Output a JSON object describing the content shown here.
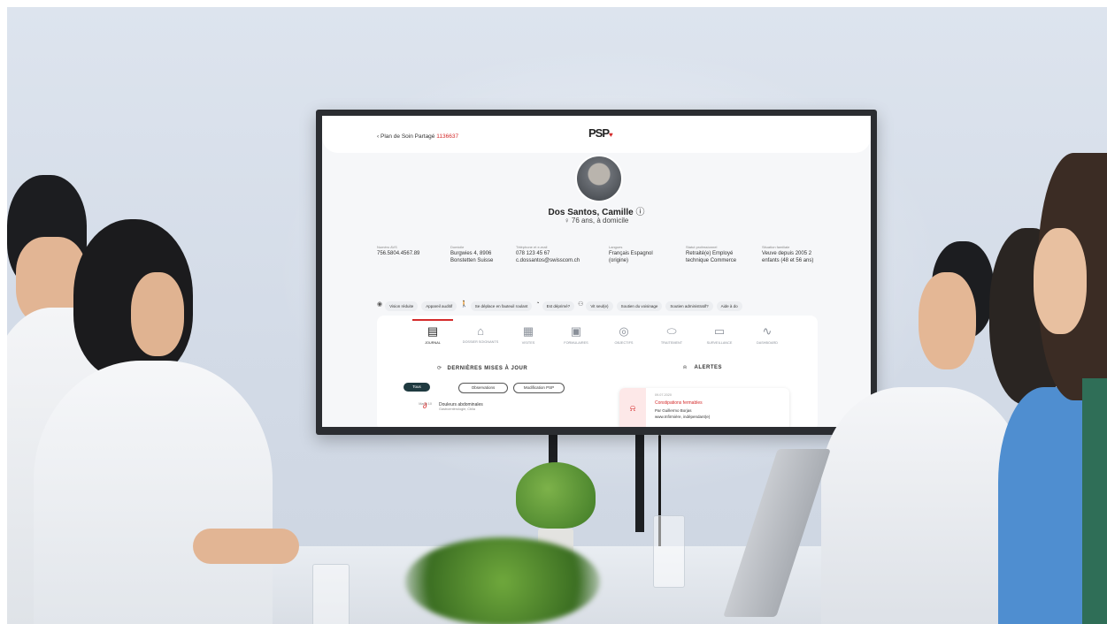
{
  "tv": {
    "back_label": "Plan de Soin Partagé",
    "back_id": "1136637",
    "logo": "PSP",
    "patient_name": "Dos Santos, Camille",
    "info_icon": "info-circle-icon",
    "patient_age": "♀ 76 ans, à domicile",
    "info_fields": [
      {
        "label": "Numéro AVS",
        "value": "756.5804.4567.89"
      },
      {
        "label": "Domicile",
        "value": "Burgwies 4, 8906 Bonstetten Suisse"
      },
      {
        "label": "Téléphone et e-mail",
        "value": "078 123 45 67 c.dossantos@swisscom.ch"
      },
      {
        "label": "Langues",
        "value": "Français Espagnol (origine)"
      },
      {
        "label": "Statut professionnel",
        "value": "Retraité(e) Employé technique Commerce"
      },
      {
        "label": "Situation familiale",
        "value": "Veuve depuis 2005 2 enfants (48 et 56 ans)"
      }
    ],
    "chips": [
      "Vision réduite",
      "Appareil auditif",
      "Se déplace en fauteuil roulant",
      "Est déprimé?",
      "Vit seul(e)",
      "Soutien du voisinage",
      "Soutien administratif?",
      "Aide à do"
    ],
    "tabs": [
      "JOURNAL",
      "DOSSIER SOIGNANTS",
      "VISITES",
      "FORMULAIRES",
      "OBJECTIFS",
      "TRAITEMENT",
      "SURVEILLANCE",
      "DASHBOARD"
    ],
    "updates_title": "DERNIÈRES MISES À JOUR",
    "alerts_title": "ALERTES",
    "filters": [
      "Tous",
      "Observations",
      "Modification PSP"
    ],
    "event": {
      "date": "Mardi 10",
      "title": "Douleurs abdominales",
      "sub": "Gastroentérologie, Cblia"
    },
    "alert": {
      "date": "09.07.2020",
      "title": "Constipations fermables",
      "by": "Par Guillermo Borjas",
      "note": "www.Infirmière, indépendant(e)"
    }
  },
  "colors": {
    "accent": "#d42b2b",
    "dark_button": "#1f3a40"
  }
}
